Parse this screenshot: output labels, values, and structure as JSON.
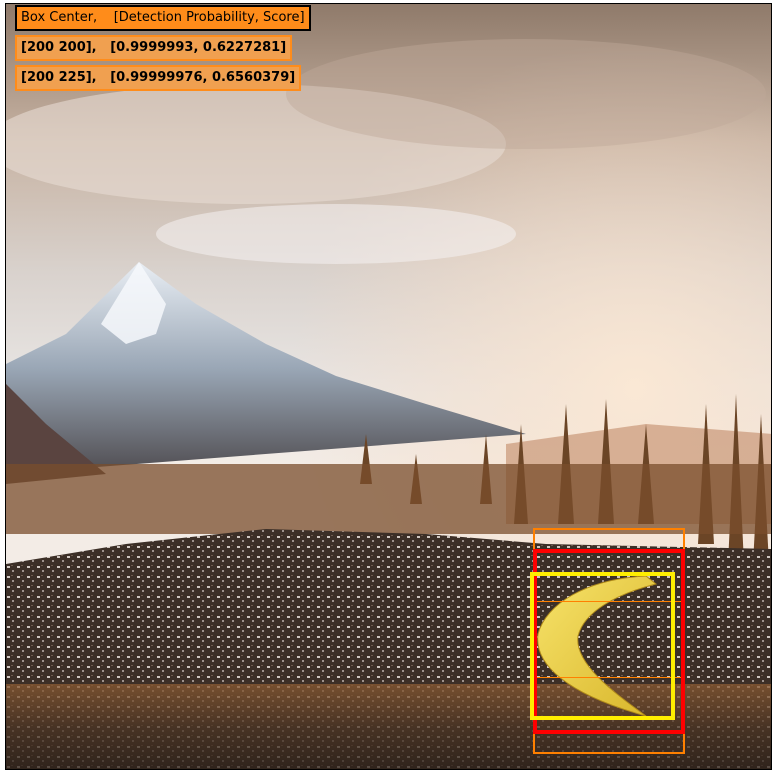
{
  "legend": {
    "header": "Box Center,    [Detection Probability, Score]",
    "rows": [
      "[200 200],   [0.9999993, 0.6227281]",
      "[200 225],   [0.99999976, 0.6560379]"
    ]
  },
  "colors": {
    "legend_fill": "#ff8c1a",
    "header_border": "#000000",
    "row_border": "#ff8c1a",
    "box_orange": "#ff8000",
    "box_red": "#ff0000",
    "box_yellow": "#ffee00"
  },
  "scene": {
    "description_icon": "mountain-landscape-image",
    "object": "banana-icon"
  }
}
